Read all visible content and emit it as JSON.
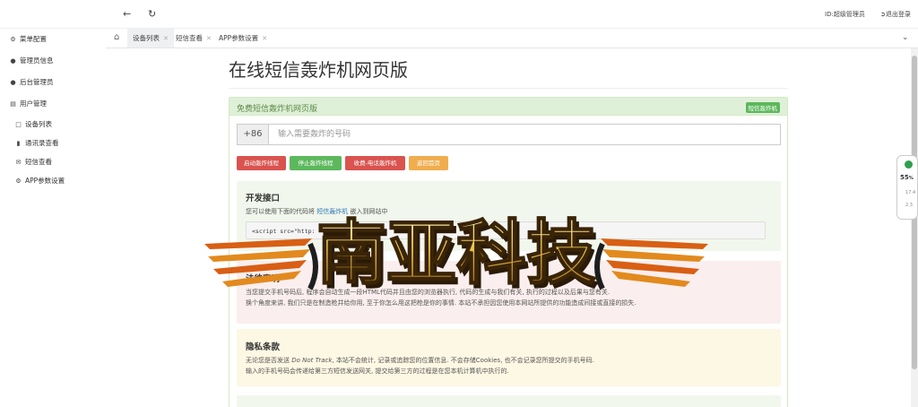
{
  "topbar": {
    "back_icon": "arrow-left-icon",
    "refresh_icon": "refresh-icon",
    "user_label": "ID:超级管理员",
    "logout_label": "退出登录"
  },
  "sidebar": {
    "items": [
      {
        "label": "菜单配置",
        "icon": "gear-icon"
      },
      {
        "label": "管理员信息",
        "icon": "user-icon"
      },
      {
        "label": "后台管理员",
        "icon": "user-icon"
      },
      {
        "label": "用户管理",
        "icon": "id-card-icon"
      },
      {
        "label": "设备列表",
        "icon": "lock-icon"
      },
      {
        "label": "通讯录查看",
        "icon": "book-icon"
      },
      {
        "label": "短信查看",
        "icon": "envelope-icon"
      },
      {
        "label": "APP参数设置",
        "icon": "gear-icon"
      }
    ]
  },
  "tabs": [
    {
      "label": "设备列表",
      "active": true
    },
    {
      "label": "短信查看",
      "active": false
    },
    {
      "label": "APP参数设置",
      "active": false
    }
  ],
  "page": {
    "title": "在线短信轰炸机网页版",
    "panel_title": "免费短信轰炸机网页版",
    "panel_badge": "短信轰炸机",
    "country_code": "+86",
    "phone_placeholder": "输入需要轰炸的号码",
    "buttons": [
      {
        "label": "启动轰炸线程",
        "color": "#d9534f"
      },
      {
        "label": "停止轰炸线程",
        "color": "#5cb85c"
      },
      {
        "label": "收费-电话轰炸机",
        "color": "#d9534f"
      },
      {
        "label": "返回首页",
        "color": "#f0ad4e"
      }
    ],
    "dev": {
      "title": "开发接口",
      "text_before": "您可以使用下面的代码将",
      "link": "短信轰炸机",
      "text_after": "嵌入到网站中",
      "code": "<script src=\"http:"
    },
    "legal": {
      "title": "法律声明",
      "line1": "当您提交手机号码后, 程序会自动生成一段HTML代码并且由您的浏览器执行, 代码的生成与我们有关, 执行的过程以及后果与您有关.",
      "line2": "换个角度来讲, 我们只是在制造枪并给你用, 至于你怎么用这把枪是你的事情. 本站不承担因您使用本网站所提供的功能造成间接或直接的损失."
    },
    "privacy": {
      "title": "隐私条款",
      "line1_a": "无论您是否发送 ",
      "line1_em": "Do Not Track",
      "line1_b": ", 本站不会统计, 记录或追踪您的位置信息. 不会存储Cookies, 也不会记录您所提交的手机号码.",
      "line2": "输入的手机号码会传递给第三方短信发送网关, 提交给第三方的过程是在您本机计算机中执行的."
    }
  },
  "watermark": {
    "text": "南亚科技"
  },
  "widget": {
    "value": "55",
    "unit": "%",
    "stat1": "17.4",
    "stat2": "2.3"
  },
  "colors": {
    "panel_head_bg": "#dff0d8",
    "dev_well_bg": "#f1f7ec",
    "legal_well_bg": "#fbeeee",
    "privacy_well_bg": "#fdf8e4"
  }
}
